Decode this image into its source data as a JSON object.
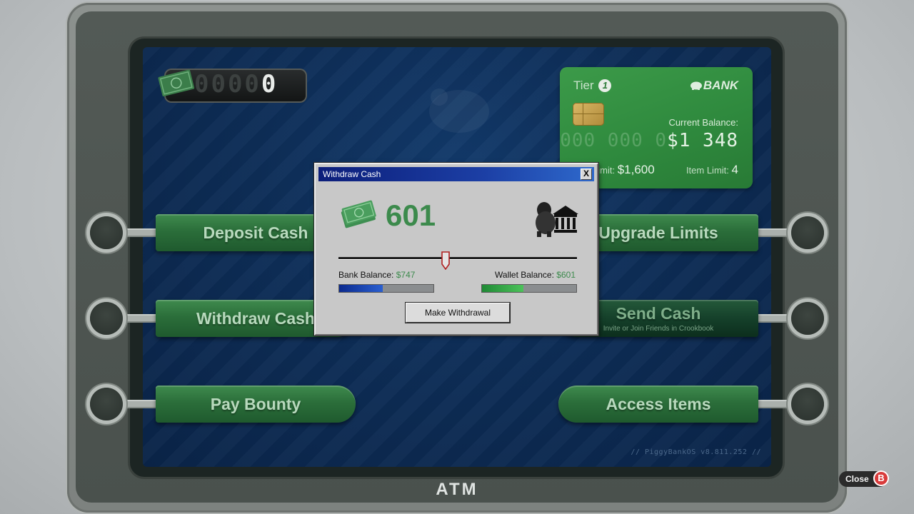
{
  "atm_label": "ATM",
  "cash_counter": {
    "digits_dim": "0000",
    "digit_last": "0",
    "icon": "cash-icon"
  },
  "bank_card": {
    "tier_label": "Tier",
    "tier_number": "1",
    "bank_name": "BANK",
    "current_balance_label": "Current Balance:",
    "balance_placeholder": "000 000 0",
    "balance_amount": "$1 348",
    "limit_label": "Limit:",
    "limit_value": "$1,600",
    "item_limit_label": "Item Limit:",
    "item_limit_value": "4"
  },
  "menu": {
    "deposit": "Deposit Cash",
    "withdraw": "Withdraw Cash",
    "pay_bounty": "Pay Bounty",
    "upgrade": "Upgrade Limits",
    "send_cash": "Send Cash",
    "send_cash_sub": "Invite or Join Friends in Crookbook",
    "access_items": "Access Items"
  },
  "version": "// PiggyBankOS v8.811.252 //",
  "dialog": {
    "title": "Withdraw Cash",
    "close_label": "X",
    "amount": "601",
    "bank_balance_label": "Bank Balance:",
    "bank_balance_value": "$747",
    "wallet_balance_label": "Wallet Balance:",
    "wallet_balance_value": "$601",
    "button": "Make Withdrawal",
    "slider_fraction": 0.45,
    "bank_bar_fraction": 0.46,
    "wallet_bar_fraction": 0.44,
    "colors": {
      "title_bar": "#0c1e7a",
      "accent_green": "#3c8a4c"
    }
  },
  "close_hint": {
    "label": "Close",
    "button": "B"
  }
}
